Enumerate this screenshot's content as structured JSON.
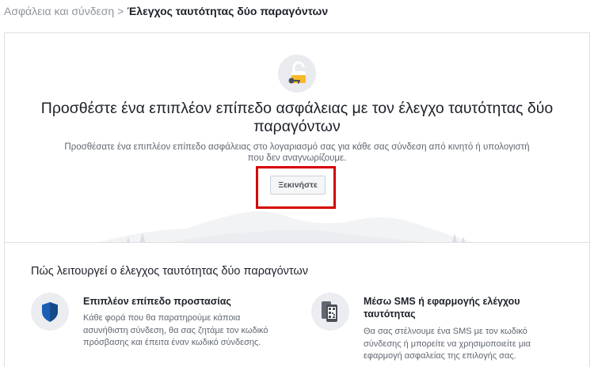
{
  "breadcrumb": {
    "parent": "Ασφάλεια και σύνδεση",
    "separator": ">",
    "current": "Έλεγχος ταυτότητας δύο παραγόντων"
  },
  "hero": {
    "icon": "lock-key-icon",
    "title": "Προσθέστε ένα επιπλέον επίπεδο ασφάλειας με τον έλεγχο ταυτότητας δύο παραγόντων",
    "description": "Προσθέσατε ένα επιπλέον επίπεδο ασφάλειας στο λογαριασμό σας για κάθε σας σύνδεση από κινητό ή υπολογιστή που δεν αναγνωρίζουμε.",
    "button_label": "Ξεκινήστε"
  },
  "how_it_works": {
    "title": "Πώς λειτουργεί ο έλεγχος ταυτότητας δύο παραγόντων",
    "features": [
      {
        "icon": "shield-icon",
        "title": "Επιπλέον επίπεδο προστασίας",
        "text": "Κάθε φορά που θα παρατηρούμε κάποια ασυνήθιστη σύνδεση, θα σας ζητάμε τον κωδικό πρόσβασης και έπειτα έναν κωδικό σύνδεσης."
      },
      {
        "icon": "phone-qr-icon",
        "title": "Μέσω SMS ή εφαρμογής ελέγχου ταυτότητας",
        "text": "Θα σας στέλνουμε ένα SMS με τον κωδικό σύνδεσης ή μπορείτε να χρησιμοποιείτε μια εφαρμογή ασφαλείας της επιλογής σας."
      }
    ]
  },
  "colors": {
    "highlight": "#d60000",
    "shield": "#1a5fb4",
    "lock": "#f7b928"
  }
}
